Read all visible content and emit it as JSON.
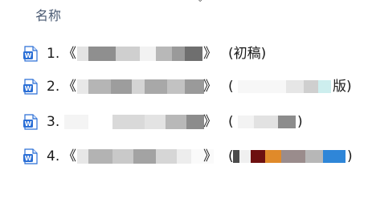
{
  "header": {
    "name_column": "名称"
  },
  "files": [
    {
      "index": "1.",
      "open_quote": "《",
      "close_quote": "》",
      "suffix_open": "(初稿)"
    },
    {
      "index": "2.",
      "open_quote": "《",
      "close_quote": "》",
      "suffix_open": "(",
      "suffix_close": "版)"
    },
    {
      "index": "3.",
      "open_quote": "《",
      "close_quote": "》",
      "suffix_open": "(",
      "suffix_close": ")"
    },
    {
      "index": "4.",
      "open_quote": "《",
      "close_quote": "》",
      "suffix_open": "(",
      "suffix_close": ")"
    }
  ],
  "icon": {
    "name": "word-document-icon",
    "color": "#2b6fd6",
    "letter": "W"
  }
}
